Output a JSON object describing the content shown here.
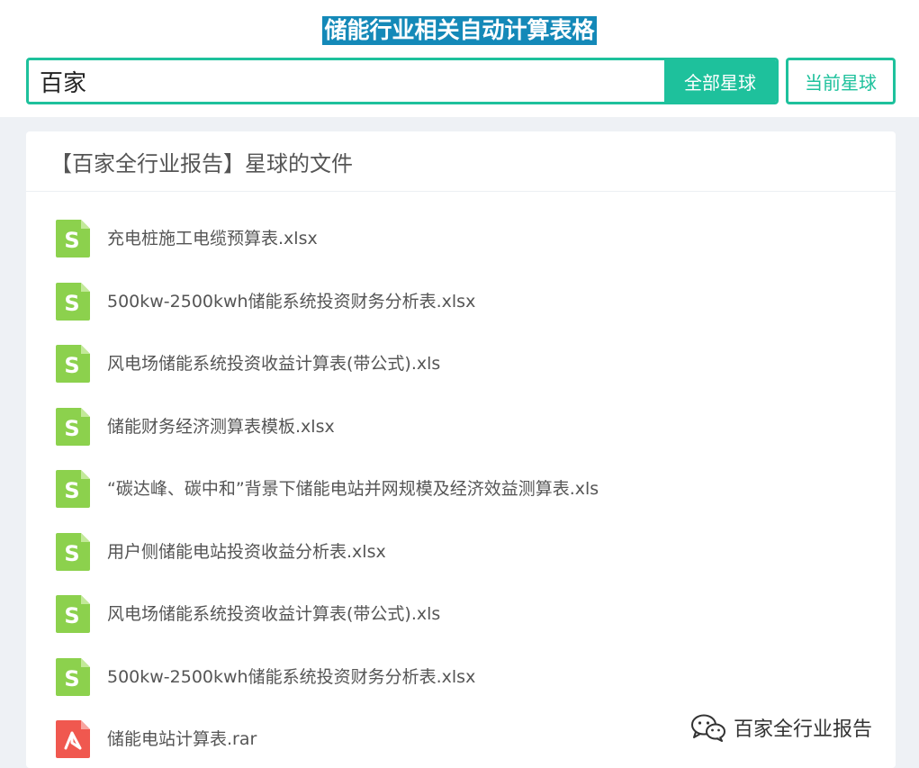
{
  "header": {
    "title": "储能行业相关自动计算表格"
  },
  "search": {
    "value": "百家",
    "all_button": "全部星球",
    "current_button": "当前星球"
  },
  "panel": {
    "title": "【百家全行业报告】星球的文件",
    "files": [
      {
        "name": "充电桩施工电缆预算表.xlsx",
        "icon": "spreadsheet-icon",
        "color": "#8cd14d"
      },
      {
        "name": "500kw-2500kwh储能系统投资财务分析表.xlsx",
        "icon": "spreadsheet-icon",
        "color": "#8cd14d"
      },
      {
        "name": "风电场储能系统投资收益计算表(带公式).xls",
        "icon": "spreadsheet-icon",
        "color": "#8cd14d"
      },
      {
        "name": "储能财务经济测算表模板.xlsx",
        "icon": "spreadsheet-icon",
        "color": "#8cd14d"
      },
      {
        "name": "“碳达峰、碳中和”背景下储能电站并网规模及经济效益测算表.xls",
        "icon": "spreadsheet-icon",
        "color": "#8cd14d"
      },
      {
        "name": "用户侧储能电站投资收益分析表.xlsx",
        "icon": "spreadsheet-icon",
        "color": "#8cd14d"
      },
      {
        "name": "风电场储能系统投资收益计算表(带公式).xls",
        "icon": "spreadsheet-icon",
        "color": "#8cd14d"
      },
      {
        "name": "500kw-2500kwh储能系统投资财务分析表.xlsx",
        "icon": "spreadsheet-icon",
        "color": "#8cd14d"
      },
      {
        "name": "储能电站计算表.rar",
        "icon": "archive-icon",
        "color": "#f0584f"
      }
    ]
  },
  "watermark": {
    "text": "百家全行业报告",
    "icon": "wechat-icon"
  },
  "colors": {
    "accent": "#1ec19c",
    "title_bg": "#1489b8"
  }
}
